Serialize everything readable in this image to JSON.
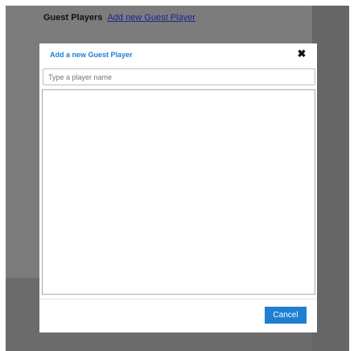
{
  "background": {
    "heading_title": "Guest Players",
    "heading_link": "Add new Guest Player"
  },
  "modal": {
    "title": "Add a new Guest Player",
    "close_glyph": "✖",
    "search": {
      "placeholder": "Type a player name",
      "value": ""
    },
    "cancel_label": "Cancel",
    "icons": {
      "close": "close-icon"
    },
    "colors": {
      "accent": "#1f7fd0",
      "overlay": "#7c7c7c"
    }
  }
}
